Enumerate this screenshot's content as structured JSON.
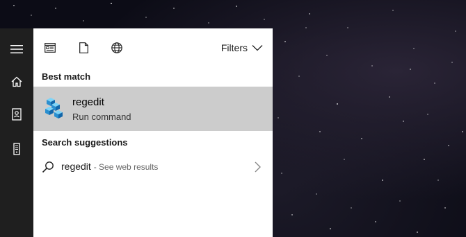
{
  "rail": {
    "items": [
      {
        "icon": "hamburger-menu-icon"
      },
      {
        "icon": "home-icon"
      },
      {
        "icon": "notebook-icon"
      },
      {
        "icon": "tower-device-icon"
      }
    ]
  },
  "toolbar": {
    "icons": [
      "apps-icon",
      "documents-icon",
      "web-icon"
    ],
    "filters_label": "Filters"
  },
  "best_match": {
    "heading": "Best match",
    "title": "regedit",
    "subtitle": "Run command",
    "icon": "regedit-icon",
    "highlight_color": "#cccccc"
  },
  "suggestions": {
    "heading": "Search suggestions",
    "items": [
      {
        "query": "regedit",
        "hint": "- See web results",
        "icon": "search-icon"
      }
    ]
  },
  "colors": {
    "rail": "#1f1f1f",
    "panel": "#ffffff"
  }
}
